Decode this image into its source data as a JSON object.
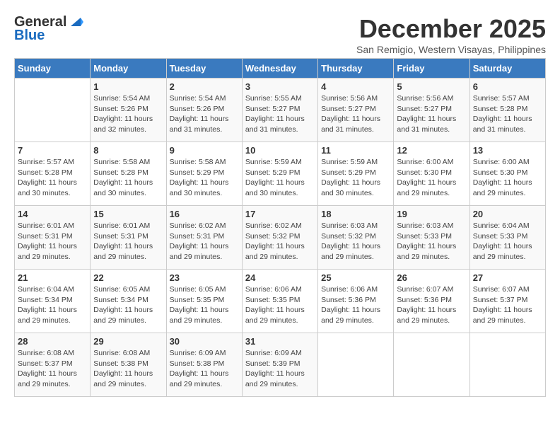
{
  "header": {
    "logo_general": "General",
    "logo_blue": "Blue",
    "title": "December 2025",
    "subtitle": "San Remigio, Western Visayas, Philippines"
  },
  "days_of_week": [
    "Sunday",
    "Monday",
    "Tuesday",
    "Wednesday",
    "Thursday",
    "Friday",
    "Saturday"
  ],
  "weeks": [
    [
      {
        "day": "",
        "info": ""
      },
      {
        "day": "1",
        "info": "Sunrise: 5:54 AM\nSunset: 5:26 PM\nDaylight: 11 hours\nand 32 minutes."
      },
      {
        "day": "2",
        "info": "Sunrise: 5:54 AM\nSunset: 5:26 PM\nDaylight: 11 hours\nand 31 minutes."
      },
      {
        "day": "3",
        "info": "Sunrise: 5:55 AM\nSunset: 5:27 PM\nDaylight: 11 hours\nand 31 minutes."
      },
      {
        "day": "4",
        "info": "Sunrise: 5:56 AM\nSunset: 5:27 PM\nDaylight: 11 hours\nand 31 minutes."
      },
      {
        "day": "5",
        "info": "Sunrise: 5:56 AM\nSunset: 5:27 PM\nDaylight: 11 hours\nand 31 minutes."
      },
      {
        "day": "6",
        "info": "Sunrise: 5:57 AM\nSunset: 5:28 PM\nDaylight: 11 hours\nand 31 minutes."
      }
    ],
    [
      {
        "day": "7",
        "info": "Sunrise: 5:57 AM\nSunset: 5:28 PM\nDaylight: 11 hours\nand 30 minutes."
      },
      {
        "day": "8",
        "info": "Sunrise: 5:58 AM\nSunset: 5:28 PM\nDaylight: 11 hours\nand 30 minutes."
      },
      {
        "day": "9",
        "info": "Sunrise: 5:58 AM\nSunset: 5:29 PM\nDaylight: 11 hours\nand 30 minutes."
      },
      {
        "day": "10",
        "info": "Sunrise: 5:59 AM\nSunset: 5:29 PM\nDaylight: 11 hours\nand 30 minutes."
      },
      {
        "day": "11",
        "info": "Sunrise: 5:59 AM\nSunset: 5:29 PM\nDaylight: 11 hours\nand 30 minutes."
      },
      {
        "day": "12",
        "info": "Sunrise: 6:00 AM\nSunset: 5:30 PM\nDaylight: 11 hours\nand 29 minutes."
      },
      {
        "day": "13",
        "info": "Sunrise: 6:00 AM\nSunset: 5:30 PM\nDaylight: 11 hours\nand 29 minutes."
      }
    ],
    [
      {
        "day": "14",
        "info": "Sunrise: 6:01 AM\nSunset: 5:31 PM\nDaylight: 11 hours\nand 29 minutes."
      },
      {
        "day": "15",
        "info": "Sunrise: 6:01 AM\nSunset: 5:31 PM\nDaylight: 11 hours\nand 29 minutes."
      },
      {
        "day": "16",
        "info": "Sunrise: 6:02 AM\nSunset: 5:31 PM\nDaylight: 11 hours\nand 29 minutes."
      },
      {
        "day": "17",
        "info": "Sunrise: 6:02 AM\nSunset: 5:32 PM\nDaylight: 11 hours\nand 29 minutes."
      },
      {
        "day": "18",
        "info": "Sunrise: 6:03 AM\nSunset: 5:32 PM\nDaylight: 11 hours\nand 29 minutes."
      },
      {
        "day": "19",
        "info": "Sunrise: 6:03 AM\nSunset: 5:33 PM\nDaylight: 11 hours\nand 29 minutes."
      },
      {
        "day": "20",
        "info": "Sunrise: 6:04 AM\nSunset: 5:33 PM\nDaylight: 11 hours\nand 29 minutes."
      }
    ],
    [
      {
        "day": "21",
        "info": "Sunrise: 6:04 AM\nSunset: 5:34 PM\nDaylight: 11 hours\nand 29 minutes."
      },
      {
        "day": "22",
        "info": "Sunrise: 6:05 AM\nSunset: 5:34 PM\nDaylight: 11 hours\nand 29 minutes."
      },
      {
        "day": "23",
        "info": "Sunrise: 6:05 AM\nSunset: 5:35 PM\nDaylight: 11 hours\nand 29 minutes."
      },
      {
        "day": "24",
        "info": "Sunrise: 6:06 AM\nSunset: 5:35 PM\nDaylight: 11 hours\nand 29 minutes."
      },
      {
        "day": "25",
        "info": "Sunrise: 6:06 AM\nSunset: 5:36 PM\nDaylight: 11 hours\nand 29 minutes."
      },
      {
        "day": "26",
        "info": "Sunrise: 6:07 AM\nSunset: 5:36 PM\nDaylight: 11 hours\nand 29 minutes."
      },
      {
        "day": "27",
        "info": "Sunrise: 6:07 AM\nSunset: 5:37 PM\nDaylight: 11 hours\nand 29 minutes."
      }
    ],
    [
      {
        "day": "28",
        "info": "Sunrise: 6:08 AM\nSunset: 5:37 PM\nDaylight: 11 hours\nand 29 minutes."
      },
      {
        "day": "29",
        "info": "Sunrise: 6:08 AM\nSunset: 5:38 PM\nDaylight: 11 hours\nand 29 minutes."
      },
      {
        "day": "30",
        "info": "Sunrise: 6:09 AM\nSunset: 5:38 PM\nDaylight: 11 hours\nand 29 minutes."
      },
      {
        "day": "31",
        "info": "Sunrise: 6:09 AM\nSunset: 5:39 PM\nDaylight: 11 hours\nand 29 minutes."
      },
      {
        "day": "",
        "info": ""
      },
      {
        "day": "",
        "info": ""
      },
      {
        "day": "",
        "info": ""
      }
    ]
  ]
}
